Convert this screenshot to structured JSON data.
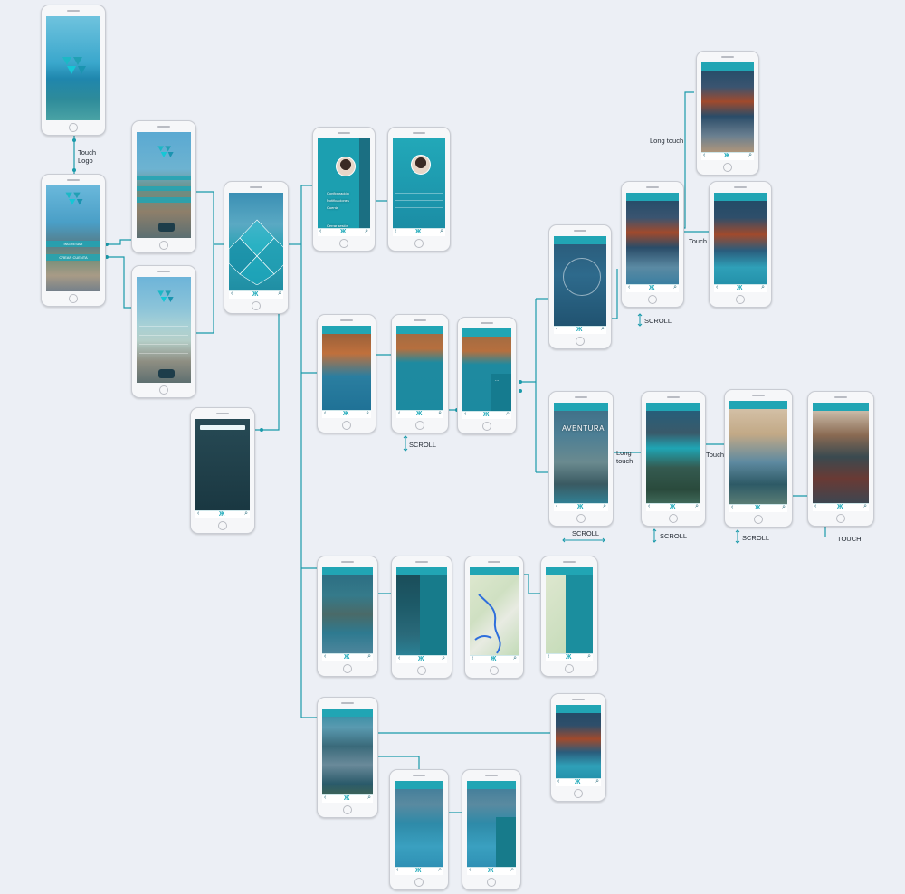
{
  "annotations": {
    "touch_logo": [
      "Touch",
      "Logo"
    ],
    "long_touch_1": "Long touch",
    "touch_1": "Touch",
    "scroll_1": "SCROLL",
    "scroll_2": "SCROLL",
    "long_touch_2": [
      "Long",
      "touch"
    ],
    "touch_2": "Touch",
    "scroll_3": "SCROLL",
    "scroll_4": "SCROLL",
    "scroll_5": "SCROLL",
    "touch_3": "TOUCH"
  },
  "screens": {
    "aventura_title": "AVENTURA",
    "menu_item_2": "Configuración",
    "menu_item_3": "Notificaciones",
    "menu_item_4": "Cuenta",
    "menu_close": "Cerrar sesión",
    "btn_ingresar": "INGRESAR",
    "btn_crear_cuenta": "CREAR CUENTA",
    "sidebar_dots": "..."
  },
  "colors": {
    "accent": "#21a5b4",
    "connector": "#1a9aaa",
    "background": "#eceff5"
  }
}
